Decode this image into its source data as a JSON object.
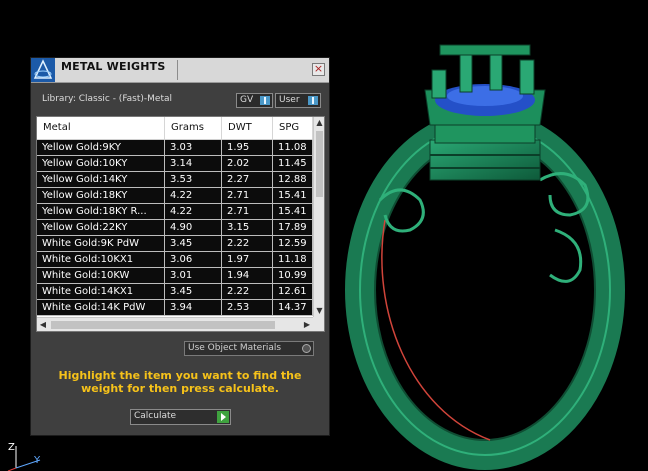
{
  "panel": {
    "title": "METAL WEIGHTS",
    "close_glyph": "×",
    "library_label": "Library: Classic - (Fast)-Metal",
    "toggle_gv": "GV",
    "toggle_user": "User",
    "use_object_materials": "Use Object Materials",
    "hint": "Highlight the item you want to find the weight for then press calculate.",
    "calculate_label": "Calculate",
    "accent_color": "#f6c21a"
  },
  "table": {
    "columns": [
      "Metal",
      "Grams",
      "DWT",
      "SPG"
    ],
    "rows": [
      [
        "Yellow Gold:9KY",
        "3.03",
        "1.95",
        "11.08"
      ],
      [
        "Yellow Gold:10KY",
        "3.14",
        "2.02",
        "11.45"
      ],
      [
        "Yellow Gold:14KY",
        "3.53",
        "2.27",
        "12.88"
      ],
      [
        "Yellow Gold:18KY",
        "4.22",
        "2.71",
        "15.41"
      ],
      [
        "Yellow Gold:18KY R...",
        "4.22",
        "2.71",
        "15.41"
      ],
      [
        "Yellow Gold:22KY",
        "4.90",
        "3.15",
        "17.89"
      ],
      [
        "White Gold:9K PdW",
        "3.45",
        "2.22",
        "12.59"
      ],
      [
        "White Gold:10KX1",
        "3.06",
        "1.97",
        "11.18"
      ],
      [
        "White Gold:10KW",
        "3.01",
        "1.94",
        "10.99"
      ],
      [
        "White Gold:14KX1",
        "3.45",
        "2.22",
        "12.61"
      ],
      [
        "White Gold:14K PdW",
        "3.94",
        "2.53",
        "14.37"
      ]
    ]
  },
  "viewport": {
    "axis_z": "Z",
    "axis_y": "Y",
    "model": "ring",
    "model_color": "#1e8a5e"
  }
}
